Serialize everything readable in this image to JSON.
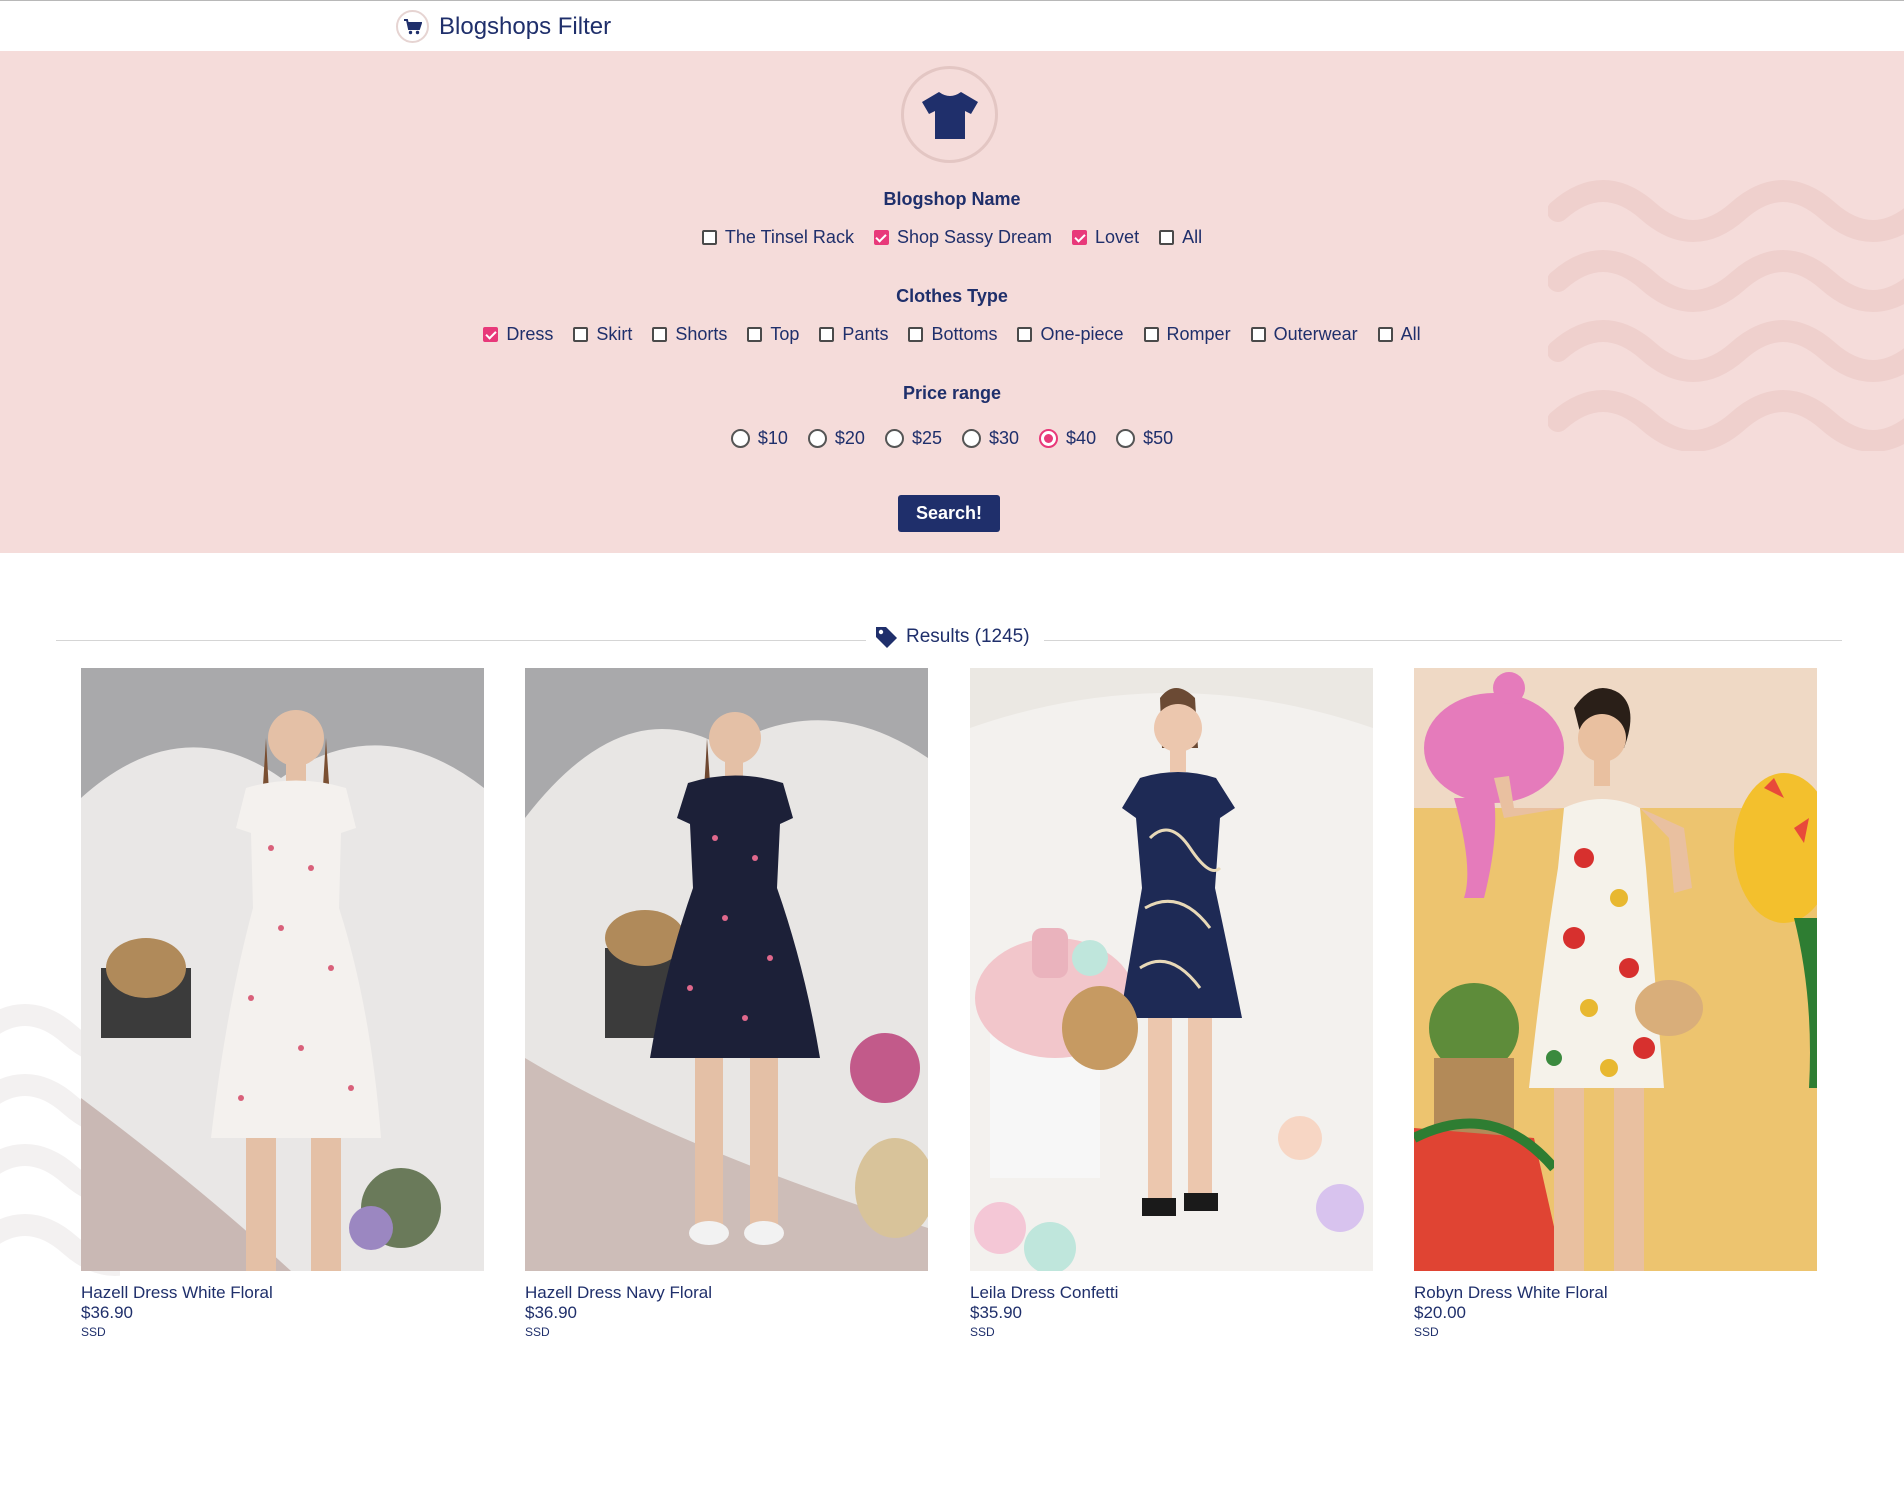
{
  "header": {
    "title": "Blogshops Filter",
    "icon": "cart-icon"
  },
  "filter": {
    "logo_icon": "tshirt-icon",
    "blogshop": {
      "title": "Blogshop Name",
      "options": [
        {
          "label": "The Tinsel Rack",
          "checked": false
        },
        {
          "label": "Shop Sassy Dream",
          "checked": true
        },
        {
          "label": "Lovet",
          "checked": true
        },
        {
          "label": "All",
          "checked": false
        }
      ]
    },
    "clothes": {
      "title": "Clothes Type",
      "options": [
        {
          "label": "Dress",
          "checked": true
        },
        {
          "label": "Skirt",
          "checked": false
        },
        {
          "label": "Shorts",
          "checked": false
        },
        {
          "label": "Top",
          "checked": false
        },
        {
          "label": "Pants",
          "checked": false
        },
        {
          "label": "Bottoms",
          "checked": false
        },
        {
          "label": "One-piece",
          "checked": false
        },
        {
          "label": "Romper",
          "checked": false
        },
        {
          "label": "Outerwear",
          "checked": false
        },
        {
          "label": "All",
          "checked": false
        }
      ]
    },
    "price": {
      "title": "Price range",
      "options": [
        {
          "label": "$10",
          "checked": false
        },
        {
          "label": "$20",
          "checked": false
        },
        {
          "label": "$25",
          "checked": false
        },
        {
          "label": "$30",
          "checked": false
        },
        {
          "label": "$40",
          "checked": true
        },
        {
          "label": "$50",
          "checked": false
        }
      ]
    },
    "search_label": "Search!"
  },
  "results": {
    "label": "Results (1245)",
    "icon": "tag-icon",
    "items": [
      {
        "name": "Hazell Dress White Floral",
        "price": "$36.90",
        "shop": "SSD",
        "dress_color": "#f4f1ee",
        "print_color": "#d9607a",
        "bg": "#e9e7e6"
      },
      {
        "name": "Hazell Dress Navy Floral",
        "price": "$36.90",
        "shop": "SSD",
        "dress_color": "#1c2038",
        "print_color": "#e0688c",
        "bg": "#e8e6e4"
      },
      {
        "name": "Leila Dress Confetti",
        "price": "$35.90",
        "shop": "SSD",
        "dress_color": "#1e2a55",
        "print_color": "#e8d9b8",
        "bg": "#f3f1ee"
      },
      {
        "name": "Robyn Dress White Floral",
        "price": "$20.00",
        "shop": "SSD",
        "dress_color": "#f5f2ea",
        "print_color": "#d7302e",
        "bg": "#edc46f"
      }
    ]
  },
  "colors": {
    "navy": "#1f2f6b",
    "pink_bg": "#f5dcda",
    "accent": "#e8397a"
  }
}
